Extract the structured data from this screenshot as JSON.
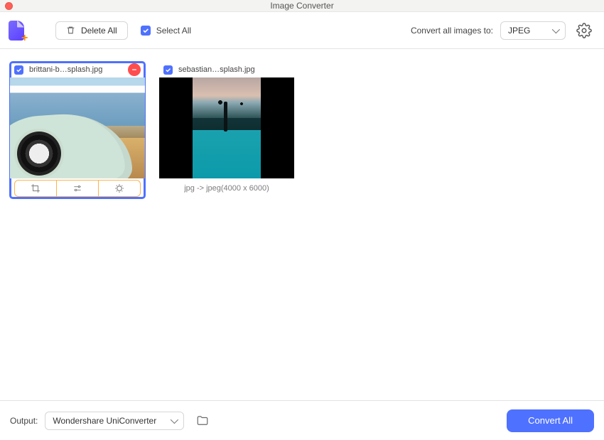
{
  "window": {
    "title": "Image Converter"
  },
  "toolbar": {
    "delete_label": "Delete All",
    "select_all_label": "Select All",
    "select_all_checked": true,
    "convert_to_label": "Convert all images to:",
    "format_selected": "JPEG"
  },
  "cards": [
    {
      "filename": "brittani-b…splash.jpg",
      "checked": true,
      "active": true,
      "footer_mode": "actions"
    },
    {
      "filename": "sebastian…splash.jpg",
      "checked": true,
      "active": false,
      "footer_mode": "info",
      "info_text": "jpg -> jpeg(4000 x 6000)"
    }
  ],
  "output": {
    "label": "Output:",
    "destination": "Wondershare UniConverter"
  },
  "convert_button_label": "Convert All"
}
